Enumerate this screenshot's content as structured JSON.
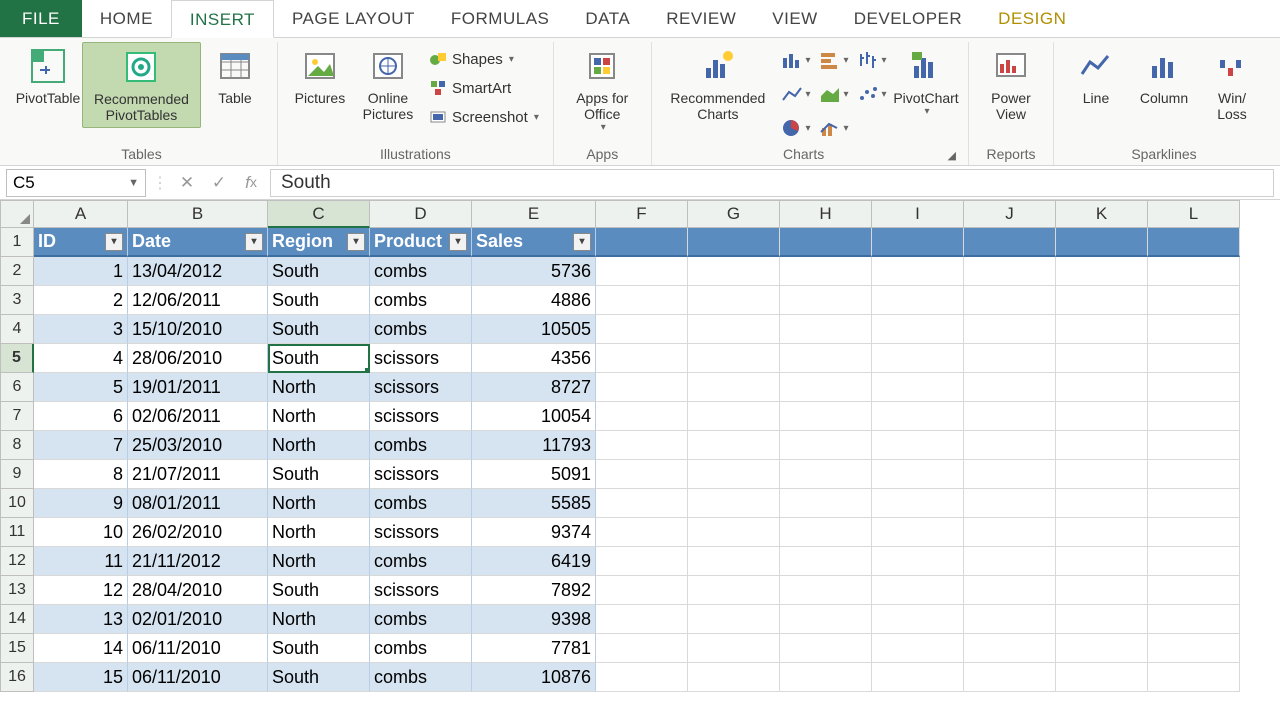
{
  "tabs": {
    "file": "FILE",
    "home": "HOME",
    "insert": "INSERT",
    "pagelayout": "PAGE LAYOUT",
    "formulas": "FORMULAS",
    "data": "DATA",
    "review": "REVIEW",
    "view": "VIEW",
    "developer": "DEVELOPER",
    "design": "DESIGN"
  },
  "ribbon": {
    "tables": {
      "label": "Tables",
      "pivot": "PivotTable",
      "recpivot": "Recommended PivotTables",
      "table": "Table"
    },
    "illus": {
      "label": "Illustrations",
      "pictures": "Pictures",
      "online": "Online Pictures",
      "shapes": "Shapes",
      "smartart": "SmartArt",
      "screenshot": "Screenshot"
    },
    "apps": {
      "label": "Apps",
      "apps": "Apps for Office"
    },
    "charts": {
      "label": "Charts",
      "rec": "Recommended Charts",
      "pivotchart": "PivotChart"
    },
    "reports": {
      "label": "Reports",
      "powerview": "Power View"
    },
    "spark": {
      "label": "Sparklines",
      "line": "Line",
      "column": "Column",
      "winloss": "Win/ Loss"
    }
  },
  "namebox": "C5",
  "formula": "South",
  "columns": [
    "A",
    "B",
    "C",
    "D",
    "E",
    "F",
    "G",
    "H",
    "I",
    "J",
    "K",
    "L"
  ],
  "headers": [
    "ID",
    "Date",
    "Region",
    "Product",
    "Sales"
  ],
  "rows": [
    {
      "n": 1
    },
    {
      "n": 2,
      "d": [
        "1",
        "13/04/2012",
        "South",
        "combs",
        "5736"
      ]
    },
    {
      "n": 3,
      "d": [
        "2",
        "12/06/2011",
        "South",
        "combs",
        "4886"
      ]
    },
    {
      "n": 4,
      "d": [
        "3",
        "15/10/2010",
        "South",
        "combs",
        "10505"
      ]
    },
    {
      "n": 5,
      "d": [
        "4",
        "28/06/2010",
        "South",
        "scissors",
        "4356"
      ]
    },
    {
      "n": 6,
      "d": [
        "5",
        "19/01/2011",
        "North",
        "scissors",
        "8727"
      ]
    },
    {
      "n": 7,
      "d": [
        "6",
        "02/06/2011",
        "North",
        "scissors",
        "10054"
      ]
    },
    {
      "n": 8,
      "d": [
        "7",
        "25/03/2010",
        "North",
        "combs",
        "11793"
      ]
    },
    {
      "n": 9,
      "d": [
        "8",
        "21/07/2011",
        "South",
        "scissors",
        "5091"
      ]
    },
    {
      "n": 10,
      "d": [
        "9",
        "08/01/2011",
        "North",
        "combs",
        "5585"
      ]
    },
    {
      "n": 11,
      "d": [
        "10",
        "26/02/2010",
        "North",
        "scissors",
        "9374"
      ]
    },
    {
      "n": 12,
      "d": [
        "11",
        "21/11/2012",
        "North",
        "combs",
        "6419"
      ]
    },
    {
      "n": 13,
      "d": [
        "12",
        "28/04/2010",
        "South",
        "scissors",
        "7892"
      ]
    },
    {
      "n": 14,
      "d": [
        "13",
        "02/01/2010",
        "North",
        "combs",
        "9398"
      ]
    },
    {
      "n": 15,
      "d": [
        "14",
        "06/11/2010",
        "South",
        "combs",
        "7781"
      ]
    },
    {
      "n": 16,
      "d": [
        "15",
        "06/11/2010",
        "South",
        "combs",
        "10876"
      ]
    }
  ],
  "active_cell": {
    "ref": "C5",
    "row": 5,
    "colIndex": 2
  },
  "colwidths": [
    "wA",
    "wB",
    "wC",
    "wD",
    "wE",
    "wRest",
    "wRest",
    "wRest",
    "wRest",
    "wRest",
    "wRest",
    "wRest"
  ]
}
